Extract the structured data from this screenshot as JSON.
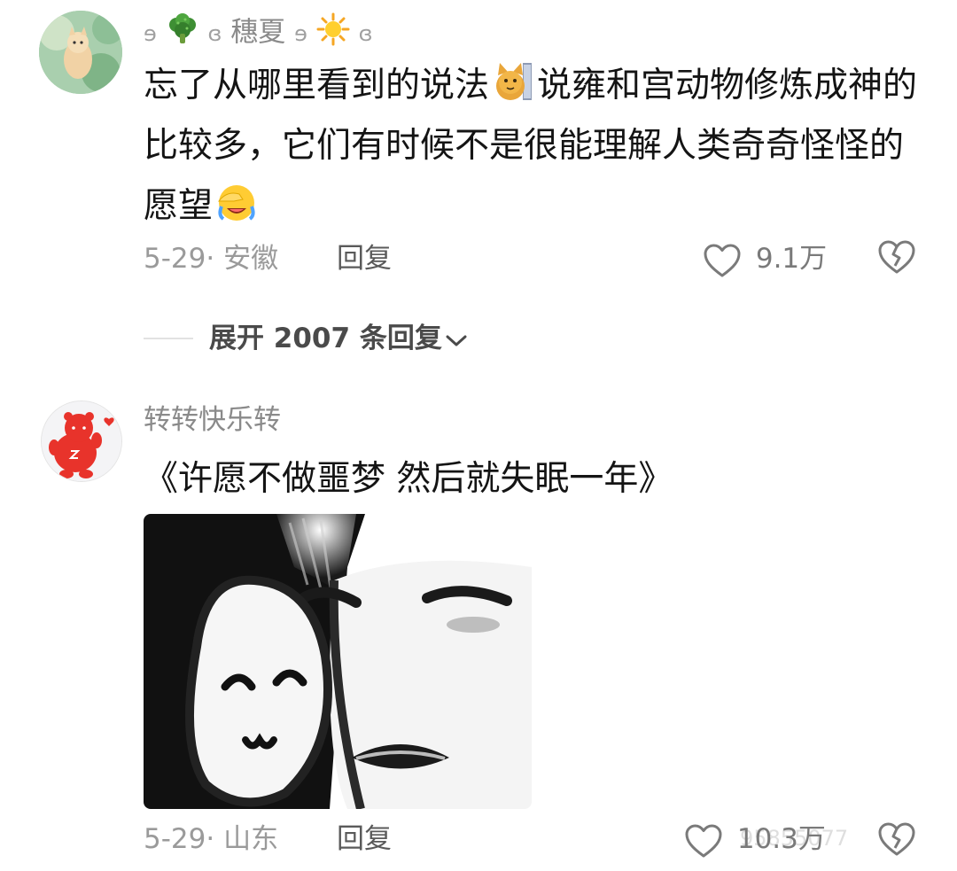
{
  "comments": [
    {
      "username_parts": [
        "ɘ",
        "ɞ",
        "穗夏",
        "ɘ",
        "ɞ"
      ],
      "username_icons": [
        "broccoli-icon",
        "sun-icon"
      ],
      "text_a": "忘了从哪里看到的说法",
      "text_b": "说雍和宫动物修炼成神的比较多，它们有时候不是很能理解人类奇奇怪怪的愿望",
      "content_emojis": [
        "cat-emoji",
        "facepalm-crying-emoji"
      ],
      "date_location": "5-29· 安徽",
      "reply_label": "回复",
      "likes": "9.1万"
    },
    {
      "username": "转转快乐转",
      "text": "《许愿不做噩梦  然后就失眠一年》",
      "image": "meme-sticker-image",
      "date_location": "5-29· 山东",
      "reply_label": "回复",
      "likes": "10.3万"
    }
  ],
  "expand_replies": "展开 2007 条回复",
  "watermark": "95855077",
  "colors": {
    "text_primary": "#141414",
    "text_secondary": "#8a8a8a",
    "meta": "#9a9a9a"
  }
}
